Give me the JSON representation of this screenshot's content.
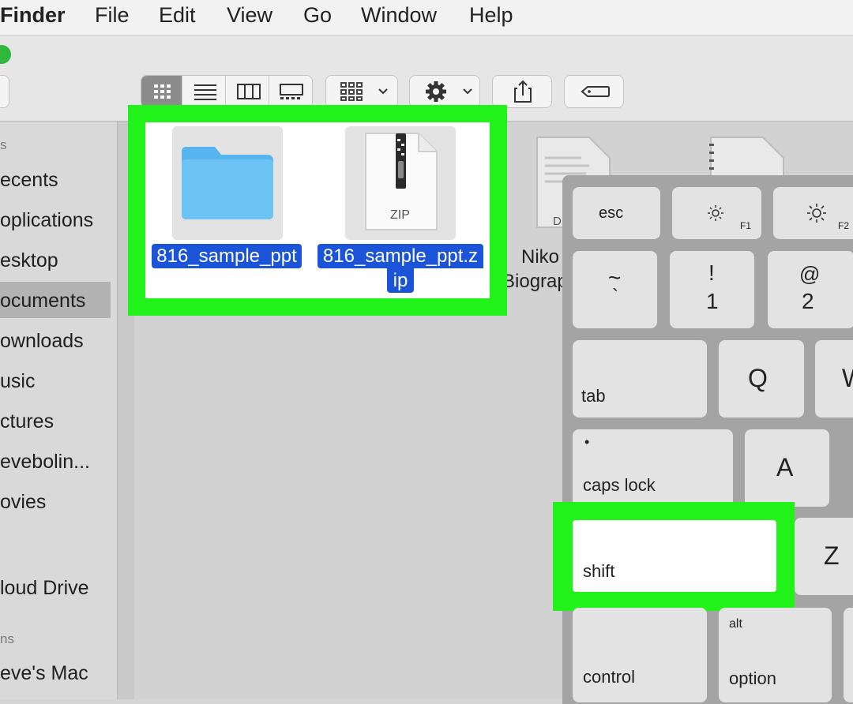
{
  "menubar": {
    "app": "Finder",
    "items": [
      "File",
      "Edit",
      "View",
      "Go",
      "Window",
      "Help"
    ]
  },
  "sidebar": {
    "section_favorites": "s",
    "items": [
      "ecents",
      "oplications",
      "esktop",
      "ocuments",
      "ownloads",
      "usic",
      "ctures",
      "evebolin...",
      "ovies"
    ],
    "selected": "ocuments",
    "cloud": "loud Drive",
    "section_locations": "ns",
    "mac": "eve's Mac"
  },
  "files": [
    {
      "label": "816_sample_ppt",
      "kind": "folder"
    },
    {
      "label_line1": "816_sample_ppt.z",
      "label_line2": "ip",
      "kind": "zip",
      "badge": "ZIP"
    },
    {
      "label_line1": "Niko",
      "label_line2": "Biograp",
      "kind": "doc",
      "badge": "D"
    }
  ],
  "keyboard": {
    "esc": "esc",
    "f1": "F1",
    "f2": "F2",
    "tilde_top": "~",
    "tilde_bottom": "`",
    "one_top": "!",
    "one_bottom": "1",
    "two_top": "@",
    "two_bottom": "2",
    "tab": "tab",
    "q": "Q",
    "w": "W",
    "capslock_dot": "•",
    "capslock": "caps lock",
    "a": "A",
    "shift": "shift",
    "z": "Z",
    "control": "control",
    "alt": "alt",
    "option": "option"
  },
  "colors": {
    "highlight": "#20f21a",
    "selection": "#1b54d8",
    "folder": "#6ec3f5"
  }
}
